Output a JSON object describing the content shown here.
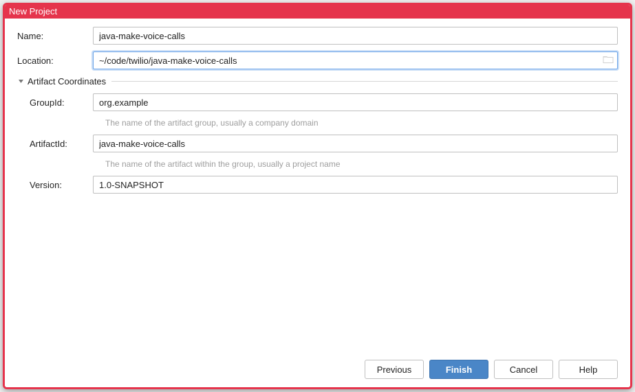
{
  "window": {
    "title": "New Project"
  },
  "form": {
    "name": {
      "label": "Name:",
      "value": "java-make-voice-calls"
    },
    "location": {
      "label": "Location:",
      "value": "~/code/twilio/java-make-voice-calls"
    }
  },
  "artifact": {
    "section_title": "Artifact Coordinates",
    "groupId": {
      "label": "GroupId:",
      "value": "org.example",
      "help": "The name of the artifact group, usually a company domain"
    },
    "artifactId": {
      "label": "ArtifactId:",
      "value": "java-make-voice-calls",
      "help": "The name of the artifact within the group, usually a project name"
    },
    "version": {
      "label": "Version:",
      "value": "1.0-SNAPSHOT"
    }
  },
  "buttons": {
    "previous": "Previous",
    "finish": "Finish",
    "cancel": "Cancel",
    "help": "Help"
  }
}
